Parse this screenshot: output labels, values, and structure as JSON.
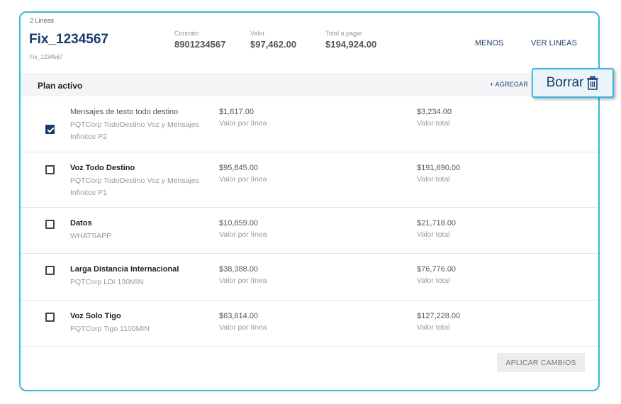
{
  "header": {
    "lines_count": "2 Lineas",
    "line_name": "Fix_1234567",
    "line_sub": "Fix_1234567",
    "contract_label": "Contrato",
    "contract_value": "8901234567",
    "value_label": "Valor",
    "value_value": "$97,462.00",
    "total_label": "Total a pagar",
    "total_value": "$194,924.00",
    "menos_label": "MENOS",
    "ver_lineas_label": "VER LINEAS"
  },
  "plan": {
    "title": "Plan activo",
    "add_label": "+  AGREGAR"
  },
  "tooltip": {
    "label": "Borrar",
    "icon": "trash-icon"
  },
  "services": [
    {
      "name": "Mensajes de texto todo destino",
      "desc": "PQTCorp TodoDestino Voz y Mensajes Infinitos P2",
      "unit_price": "$1,617.00",
      "unit_label": "Valor por línea",
      "total_price": "$3,234.00",
      "total_label": "Valor total",
      "checked": true
    },
    {
      "name": "Voz Todo Destino",
      "desc": "PQTCorp TodoDestino Voz y Mensajes Infinitos P1",
      "unit_price": "$95,845.00",
      "unit_label": "Valor por línea",
      "total_price": "$191,690.00",
      "total_label": "Valor total",
      "checked": false
    },
    {
      "name": "Datos",
      "desc": "WHATSAPP",
      "unit_price": "$10,859.00",
      "unit_label": "Valor por línea",
      "total_price": "$21,718.00",
      "total_label": "Valor total",
      "checked": false
    },
    {
      "name": "Larga Distancia Internacional",
      "desc": "PQTCorp LDI 130MIN",
      "unit_price": "$38,388.00",
      "unit_label": "Valor por línea",
      "total_price": "$76,776.00",
      "total_label": "Valor total",
      "checked": false
    },
    {
      "name": "Voz Solo Tigo",
      "desc": "PQTCorp Tigo 1100MIN",
      "unit_price": "$63,614.00",
      "unit_label": "Valor por línea",
      "total_price": "$127,228.00",
      "total_label": "Valor total",
      "checked": false
    }
  ],
  "footer": {
    "apply_label": "APLICAR CAMBIOS"
  },
  "colors": {
    "accent": "#3cb7dd",
    "primary": "#1a3a6e"
  }
}
